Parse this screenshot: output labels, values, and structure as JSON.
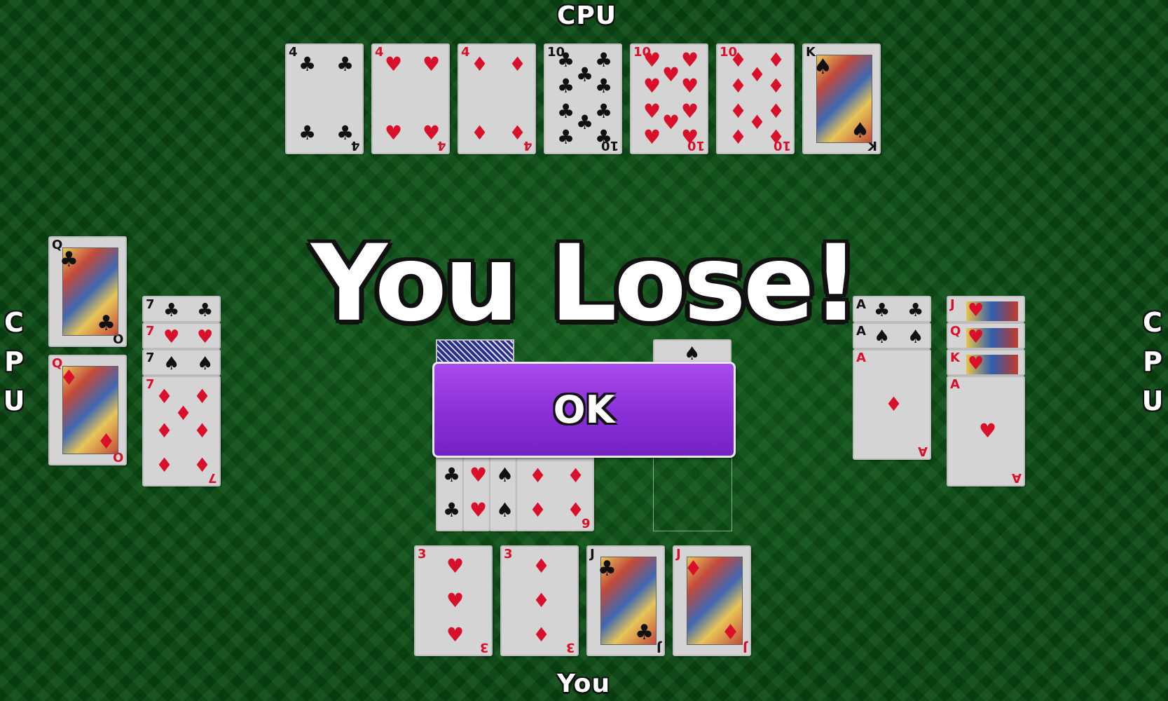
{
  "labels": {
    "top": "CPU",
    "left": [
      "C",
      "P",
      "U"
    ],
    "right": [
      "C",
      "P",
      "U"
    ],
    "bottom": "You"
  },
  "result": {
    "message": "You Lose!",
    "ok_label": "OK"
  },
  "colors": {
    "table_felt": "#0a4a14",
    "ok_button": "#8a2fd8",
    "red_suit": "#d8102a"
  },
  "top_meld": [
    {
      "rank": "4",
      "suit": "♣"
    },
    {
      "rank": "4",
      "suit": "♥"
    },
    {
      "rank": "4",
      "suit": "♦"
    },
    {
      "rank": "10",
      "suit": "♣"
    },
    {
      "rank": "10",
      "suit": "♥"
    },
    {
      "rank": "10",
      "suit": "♦"
    },
    {
      "rank": "K",
      "suit": "♠"
    }
  ],
  "left_queens": [
    {
      "rank": "Q",
      "suit": "♣"
    },
    {
      "rank": "Q",
      "suit": "♦"
    }
  ],
  "left_sevens": [
    {
      "rank": "7",
      "suit": "♣"
    },
    {
      "rank": "7",
      "suit": "♥"
    },
    {
      "rank": "7",
      "suit": "♠"
    },
    {
      "rank": "7",
      "suit": "♦"
    }
  ],
  "right_aces": [
    {
      "rank": "A",
      "suit": "♣"
    },
    {
      "rank": "A",
      "suit": "♠"
    },
    {
      "rank": "A",
      "suit": "♦"
    }
  ],
  "right_run": [
    {
      "rank": "J",
      "suit": "♥"
    },
    {
      "rank": "Q",
      "suit": "♥"
    },
    {
      "rank": "K",
      "suit": "♥"
    },
    {
      "rank": "A",
      "suit": "♥"
    }
  ],
  "center_meld": [
    {
      "rank": "6",
      "suit": "♣"
    },
    {
      "rank": "6",
      "suit": "♥"
    },
    {
      "rank": "6",
      "suit": "♠"
    },
    {
      "rank": "6",
      "suit": "♦"
    }
  ],
  "discard_top": {
    "rank": "",
    "suit": "♠"
  },
  "player_hand": [
    {
      "rank": "3",
      "suit": "♥"
    },
    {
      "rank": "3",
      "suit": "♦"
    },
    {
      "rank": "J",
      "suit": "♣"
    },
    {
      "rank": "J",
      "suit": "♦"
    }
  ]
}
